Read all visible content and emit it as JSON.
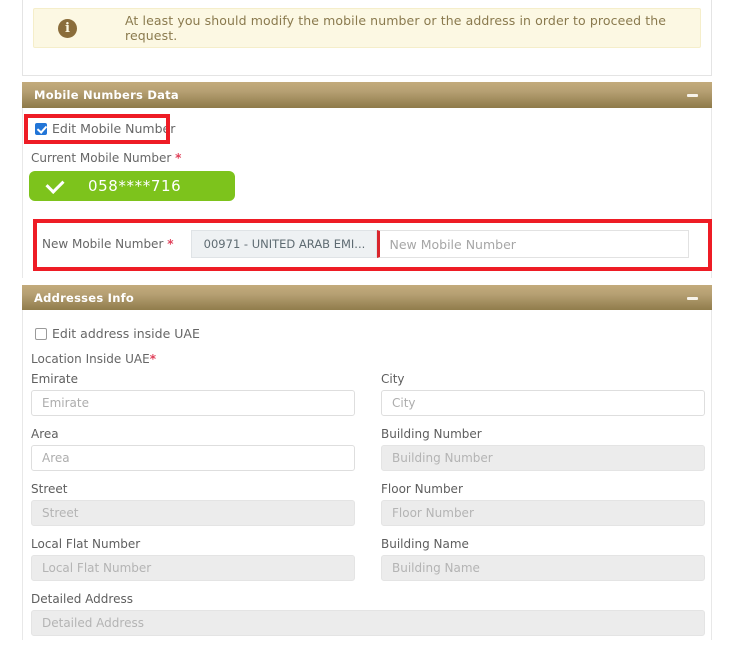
{
  "alert": {
    "icon": "info-circle-icon",
    "message": "At least you should modify the mobile number or the address in order to proceed the request."
  },
  "mobile_panel": {
    "title": "Mobile Numbers Data",
    "collapse_icon": "minus-icon",
    "edit_checkbox": {
      "label": "Edit Mobile Number",
      "checked": true
    },
    "current_number": {
      "label": "Current Mobile Number",
      "required_marker": "*",
      "value": "058****716",
      "verified_icon": "check-icon",
      "badge_color": "#7dc31c"
    },
    "new_number": {
      "label": "New Mobile Number",
      "required_marker": "*",
      "country_code": "00971 - UNITED ARAB EMI...",
      "placeholder": "New Mobile Number",
      "value": ""
    }
  },
  "addresses_panel": {
    "title": "Addresses Info",
    "collapse_icon": "minus-icon",
    "edit_checkbox": {
      "label": "Edit address inside UAE",
      "checked": false
    },
    "location_label": "Location Inside UAE",
    "location_required_marker": "*",
    "fields": [
      {
        "label": "Emirate",
        "placeholder": "Emirate",
        "value": "",
        "disabled": false
      },
      {
        "label": "City",
        "placeholder": "City",
        "value": "",
        "disabled": false
      },
      {
        "label": "Area",
        "placeholder": "Area",
        "value": "",
        "disabled": false
      },
      {
        "label": "Building Number",
        "placeholder": "Building Number",
        "value": "",
        "disabled": true
      },
      {
        "label": "Street",
        "placeholder": "Street",
        "value": "",
        "disabled": true
      },
      {
        "label": "Floor Number",
        "placeholder": "Floor Number",
        "value": "",
        "disabled": true
      },
      {
        "label": "Local Flat Number",
        "placeholder": "Local Flat Number",
        "value": "",
        "disabled": true
      },
      {
        "label": "Building Name",
        "placeholder": "Building Name",
        "value": "",
        "disabled": true
      },
      {
        "label": "Detailed Address",
        "placeholder": "Detailed Address",
        "value": "",
        "disabled": true
      }
    ]
  },
  "highlights": {
    "color": "#ee1c25",
    "regions": [
      "edit-mobile-number-checkbox",
      "new-mobile-number-row"
    ]
  }
}
